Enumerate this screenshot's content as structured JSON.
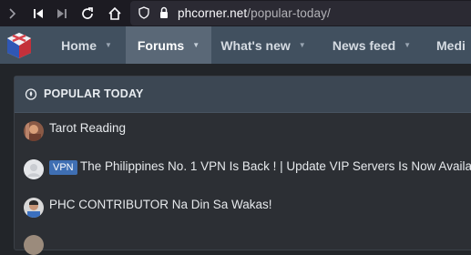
{
  "browser": {
    "url_domain": "phcorner.net",
    "url_path": "/popular-today/"
  },
  "nav": {
    "tabs": [
      {
        "label": "Home"
      },
      {
        "label": "Forums"
      },
      {
        "label": "What's new"
      },
      {
        "label": "News feed"
      },
      {
        "label": "Medi"
      }
    ]
  },
  "popular": {
    "title": "POPULAR TODAY",
    "items": [
      {
        "title": "Tarot Reading"
      },
      {
        "prefix": "VPN",
        "title": "The Philippines No. 1 VPN Is Back ! | Update VIP Servers Is Now Availa"
      },
      {
        "title": "PHC CONTRIBUTOR Na Din Sa Wakas!"
      }
    ]
  }
}
